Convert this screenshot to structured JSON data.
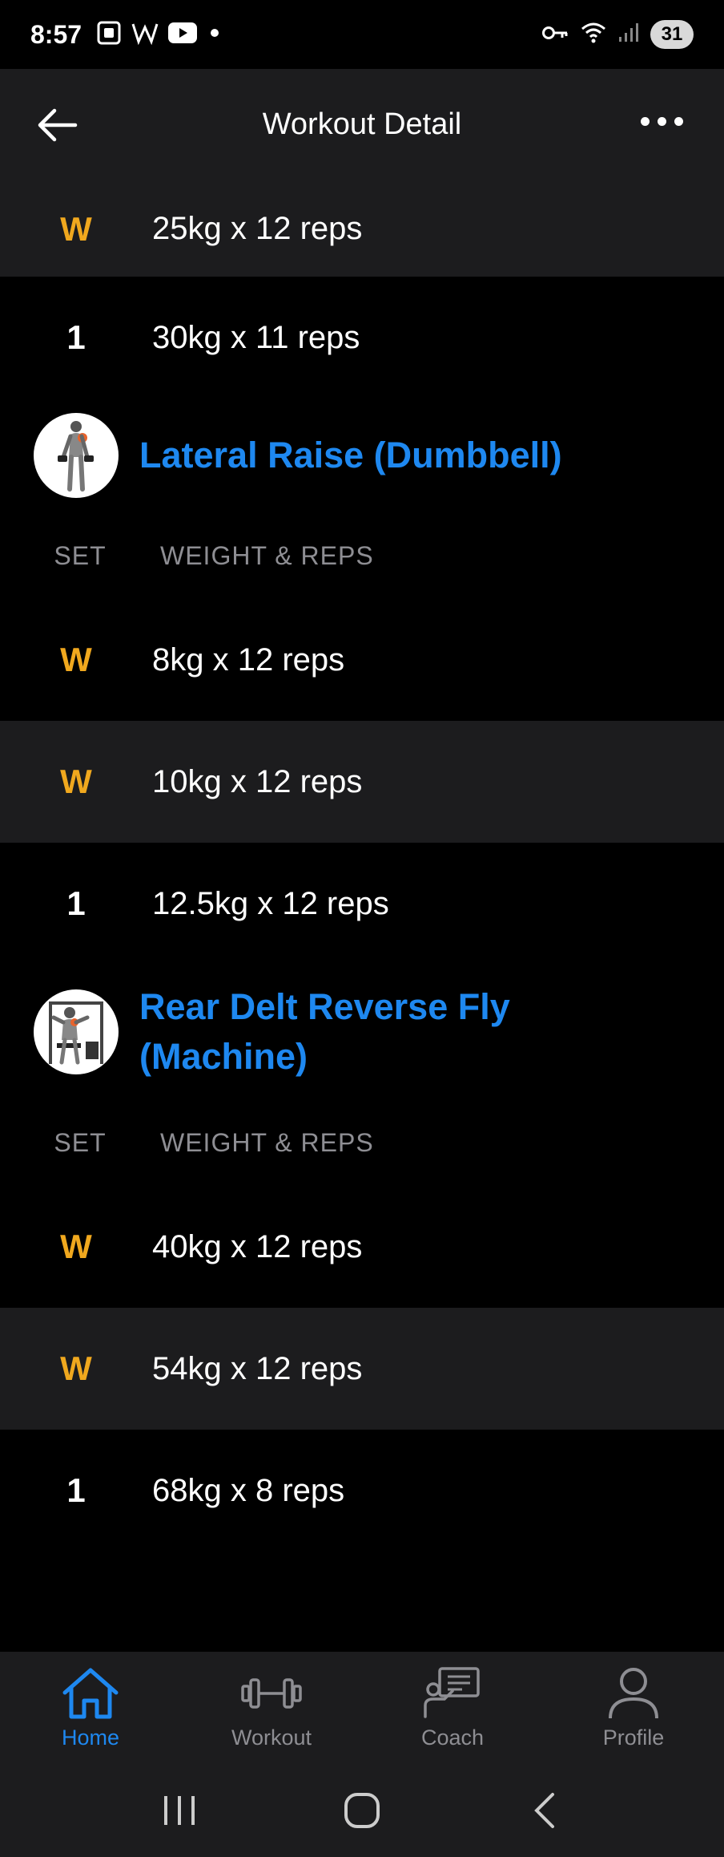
{
  "status_bar": {
    "time": "8:57",
    "battery": "31"
  },
  "header": {
    "title": "Workout Detail"
  },
  "exercises": [
    {
      "sets": [
        {
          "label": "W",
          "type": "warmup",
          "value": "25kg x 12 reps"
        },
        {
          "label": "1",
          "type": "normal",
          "value": "30kg x 11 reps"
        }
      ]
    },
    {
      "name": "Lateral Raise (Dumbbell)",
      "col_set": "SET",
      "col_weight": "WEIGHT & REPS",
      "sets": [
        {
          "label": "W",
          "type": "warmup",
          "value": "8kg x 12 reps"
        },
        {
          "label": "W",
          "type": "warmup",
          "value": "10kg x 12 reps"
        },
        {
          "label": "1",
          "type": "normal",
          "value": "12.5kg x 12 reps"
        }
      ]
    },
    {
      "name_line1": "Rear Delt Reverse Fly",
      "name_line2": "(Machine)",
      "col_set": "SET",
      "col_weight": "WEIGHT & REPS",
      "sets": [
        {
          "label": "W",
          "type": "warmup",
          "value": "40kg x 12 reps"
        },
        {
          "label": "W",
          "type": "warmup",
          "value": "54kg x 12 reps"
        },
        {
          "label": "1",
          "type": "normal",
          "value": "68kg x 8 reps"
        }
      ]
    }
  ],
  "bottom_nav": {
    "items": [
      {
        "label": "Home",
        "icon": "home-icon",
        "active": true
      },
      {
        "label": "Workout",
        "icon": "dumbbell-icon",
        "active": false
      },
      {
        "label": "Coach",
        "icon": "coach-icon",
        "active": false
      },
      {
        "label": "Profile",
        "icon": "profile-icon",
        "active": false
      }
    ]
  },
  "colors": {
    "accent": "#1e88f0",
    "warmup": "#f0a81e",
    "surface": "#1c1c1e",
    "background": "#000000",
    "muted": "#8e8e93"
  }
}
